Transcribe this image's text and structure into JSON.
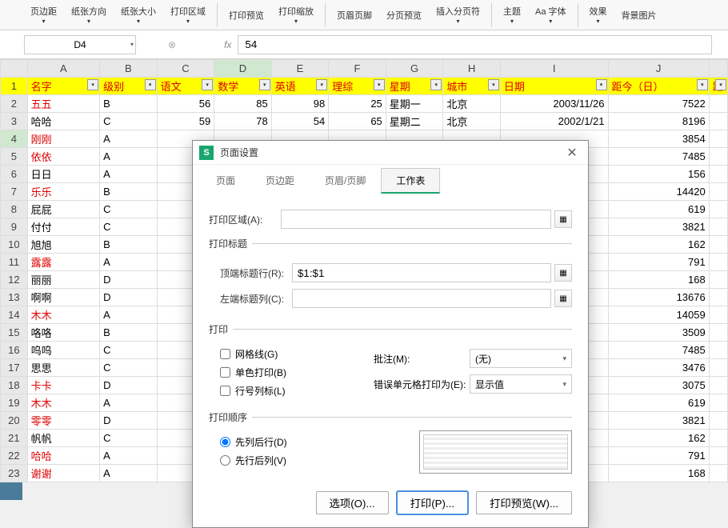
{
  "ribbon": {
    "items": [
      "页边距",
      "纸张方向",
      "纸张大小",
      "打印区域",
      "打印预览",
      "打印缩放",
      "页眉页脚",
      "分页预览",
      "插入分页符",
      "主题",
      "Aa 字体",
      "效果",
      "背景图片"
    ]
  },
  "namebox": "D4",
  "fx": "fx",
  "formula": "54",
  "columns": [
    "",
    "A",
    "B",
    "C",
    "D",
    "E",
    "F",
    "G",
    "H",
    "I",
    "J",
    ""
  ],
  "header_row": [
    "名字",
    "级别",
    "语文",
    "数学",
    "英语",
    "理综",
    "星期",
    "城市",
    "日期",
    "距今（日）",
    "距"
  ],
  "rows": [
    {
      "n": 2,
      "cells": [
        "五五",
        "B",
        "56",
        "85",
        "98",
        "25",
        "星期一",
        "北京",
        "2003/11/26",
        "7522",
        ""
      ]
    },
    {
      "n": 3,
      "cells": [
        "哈哈",
        "C",
        "59",
        "78",
        "54",
        "65",
        "星期二",
        "北京",
        "2002/1/21",
        "8196",
        ""
      ]
    },
    {
      "n": 4,
      "cells": [
        "刚刚",
        "A",
        "",
        "",
        "",
        "",
        "",
        "",
        "",
        "3854",
        ""
      ]
    },
    {
      "n": 5,
      "cells": [
        "依依",
        "A",
        "",
        "",
        "",
        "",
        "",
        "",
        "",
        "7485",
        ""
      ]
    },
    {
      "n": 6,
      "cells": [
        "日日",
        "A",
        "",
        "",
        "",
        "",
        "",
        "",
        "",
        "156",
        ""
      ]
    },
    {
      "n": 7,
      "cells": [
        "乐乐",
        "B",
        "",
        "",
        "",
        "",
        "",
        "",
        "",
        "14420",
        ""
      ]
    },
    {
      "n": 8,
      "cells": [
        "屁屁",
        "C",
        "",
        "",
        "",
        "",
        "",
        "",
        "",
        "619",
        ""
      ]
    },
    {
      "n": 9,
      "cells": [
        "付付",
        "C",
        "",
        "",
        "",
        "",
        "",
        "",
        "",
        "3821",
        ""
      ]
    },
    {
      "n": 10,
      "cells": [
        "旭旭",
        "B",
        "",
        "",
        "",
        "",
        "",
        "",
        "",
        "162",
        ""
      ]
    },
    {
      "n": 11,
      "cells": [
        "露露",
        "A",
        "",
        "",
        "",
        "",
        "",
        "",
        "",
        "791",
        ""
      ]
    },
    {
      "n": 12,
      "cells": [
        "丽丽",
        "D",
        "",
        "",
        "",
        "",
        "",
        "",
        "",
        "168",
        ""
      ]
    },
    {
      "n": 13,
      "cells": [
        "啊啊",
        "D",
        "",
        "",
        "",
        "",
        "",
        "",
        "",
        "13676",
        ""
      ]
    },
    {
      "n": 14,
      "cells": [
        "木木",
        "A",
        "",
        "",
        "",
        "",
        "",
        "",
        "",
        "14059",
        ""
      ]
    },
    {
      "n": 15,
      "cells": [
        "咯咯",
        "B",
        "",
        "",
        "",
        "",
        "",
        "",
        "",
        "3509",
        ""
      ]
    },
    {
      "n": 16,
      "cells": [
        "呜呜",
        "C",
        "",
        "",
        "",
        "",
        "",
        "",
        "",
        "7485",
        ""
      ]
    },
    {
      "n": 17,
      "cells": [
        "思思",
        "C",
        "",
        "",
        "",
        "",
        "",
        "",
        "",
        "3476",
        ""
      ]
    },
    {
      "n": 18,
      "cells": [
        "卡卡",
        "D",
        "",
        "",
        "",
        "",
        "",
        "",
        "",
        "3075",
        ""
      ]
    },
    {
      "n": 19,
      "cells": [
        "木木",
        "A",
        "",
        "",
        "",
        "",
        "",
        "",
        "",
        "619",
        ""
      ]
    },
    {
      "n": 20,
      "cells": [
        "零零",
        "D",
        "",
        "",
        "",
        "",
        "",
        "",
        "",
        "3821",
        ""
      ]
    },
    {
      "n": 21,
      "cells": [
        "帆帆",
        "C",
        "",
        "",
        "",
        "",
        "",
        "",
        "",
        "162",
        ""
      ]
    },
    {
      "n": 22,
      "cells": [
        "哈哈",
        "A",
        "",
        "",
        "",
        "",
        "",
        "",
        "",
        "791",
        ""
      ]
    },
    {
      "n": 23,
      "cells": [
        "谢谢",
        "A",
        "",
        "",
        "",
        "",
        "",
        "",
        "",
        "168",
        ""
      ]
    }
  ],
  "red_rows": [
    2,
    4,
    5,
    7,
    11,
    14,
    18,
    19,
    20,
    22,
    23
  ],
  "dialog": {
    "title": "页面设置",
    "tabs": [
      "页面",
      "页边距",
      "页眉/页脚",
      "工作表"
    ],
    "active_tab": 3,
    "print_area_label": "打印区域(A):",
    "print_titles_legend": "打印标题",
    "top_title_row_label": "顶端标题行(R):",
    "top_title_row_value": "$1:$1",
    "left_title_col_label": "左端标题列(C):",
    "print_legend": "打印",
    "gridlines": "网格线(G)",
    "monochrome": "单色打印(B)",
    "rowcol_headers": "行号列标(L)",
    "comments_label": "批注(M):",
    "comments_value": "(无)",
    "errors_label": "错误单元格打印为(E):",
    "errors_value": "显示值",
    "order_legend": "打印顺序",
    "order_down": "先列后行(D)",
    "order_over": "先行后列(V)",
    "btn_options": "选项(O)...",
    "btn_print": "打印(P)...",
    "btn_preview": "打印预览(W)..."
  }
}
